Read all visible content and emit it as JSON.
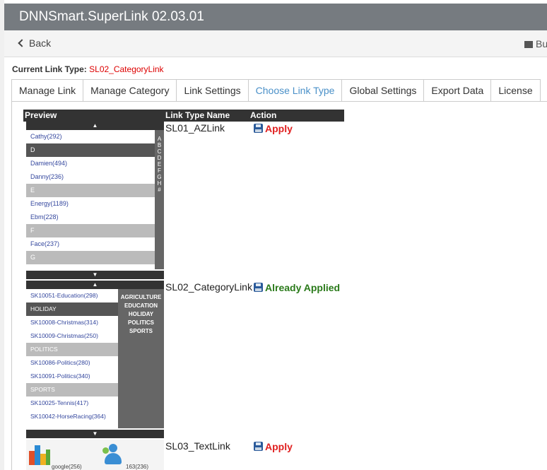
{
  "window": {
    "title": "DNNSmart.SuperLink 02.03.01"
  },
  "toolbar": {
    "back_label": "Back",
    "right_label": "Bu"
  },
  "current_link_type": {
    "label": "Current Link Type:",
    "value": "SL02_CategoryLink"
  },
  "tabs": [
    {
      "label": "Manage Link",
      "active": false
    },
    {
      "label": "Manage Category",
      "active": false
    },
    {
      "label": "Link Settings",
      "active": false
    },
    {
      "label": "Choose Link Type",
      "active": true
    },
    {
      "label": "Global Settings",
      "active": false
    },
    {
      "label": "Export Data",
      "active": false
    },
    {
      "label": "License",
      "active": false
    }
  ],
  "table": {
    "headers": {
      "preview": "Preview",
      "name": "Link Type Name",
      "action": "Action"
    },
    "rows": [
      {
        "name": "SL01_AZLink",
        "action": "Apply",
        "status": "apply"
      },
      {
        "name": "SL02_CategoryLink",
        "action": "Already Applied",
        "status": "applied"
      },
      {
        "name": "SL03_TextLink",
        "action": "Apply",
        "status": "apply"
      }
    ]
  },
  "preview_az": {
    "up": "▲",
    "down": "▼",
    "rows": [
      {
        "text": "Cathy(292)",
        "kind": "item"
      },
      {
        "text": "D",
        "kind": "dark"
      },
      {
        "text": "Damien(494)",
        "kind": "item"
      },
      {
        "text": "Danny(236)",
        "kind": "item"
      },
      {
        "text": "E",
        "kind": "light"
      },
      {
        "text": "Energy(1189)",
        "kind": "item"
      },
      {
        "text": "Ebm(228)",
        "kind": "item"
      },
      {
        "text": "F",
        "kind": "light"
      },
      {
        "text": "Face(237)",
        "kind": "item"
      },
      {
        "text": "G",
        "kind": "light"
      }
    ],
    "alphabet": [
      "A",
      "B",
      "C",
      "D",
      "E",
      "F",
      "G",
      "H",
      "#"
    ]
  },
  "preview_category": {
    "up": "▲",
    "down": "▼",
    "rows": [
      {
        "text": "SK10051-Education(298)",
        "kind": "item"
      },
      {
        "text": "HOLIDAY",
        "kind": "dark"
      },
      {
        "text": "SK10008-Christmas(314)",
        "kind": "item"
      },
      {
        "text": "SK10009-Christmas(250)",
        "kind": "item"
      },
      {
        "text": "POLITICS",
        "kind": "light"
      },
      {
        "text": "SK10086-Politics(280)",
        "kind": "item"
      },
      {
        "text": "SK10091-Politics(340)",
        "kind": "item"
      },
      {
        "text": "SPORTS",
        "kind": "light"
      },
      {
        "text": "SK10025-Tennis(417)",
        "kind": "item"
      },
      {
        "text": "SK10042-HorseRacing(364)",
        "kind": "item"
      }
    ],
    "categories": [
      "AGRICULTURE",
      "EDUCATION",
      "HOLIDAY",
      "POLITICS",
      "SPORTS"
    ]
  },
  "preview_text": {
    "label1": "google(256)",
    "label2": "163(236)"
  },
  "colors": {
    "title_bar": "#767b80",
    "active_tab": "#4a90c8",
    "apply": "#e02020",
    "applied": "#2a7a1a"
  }
}
